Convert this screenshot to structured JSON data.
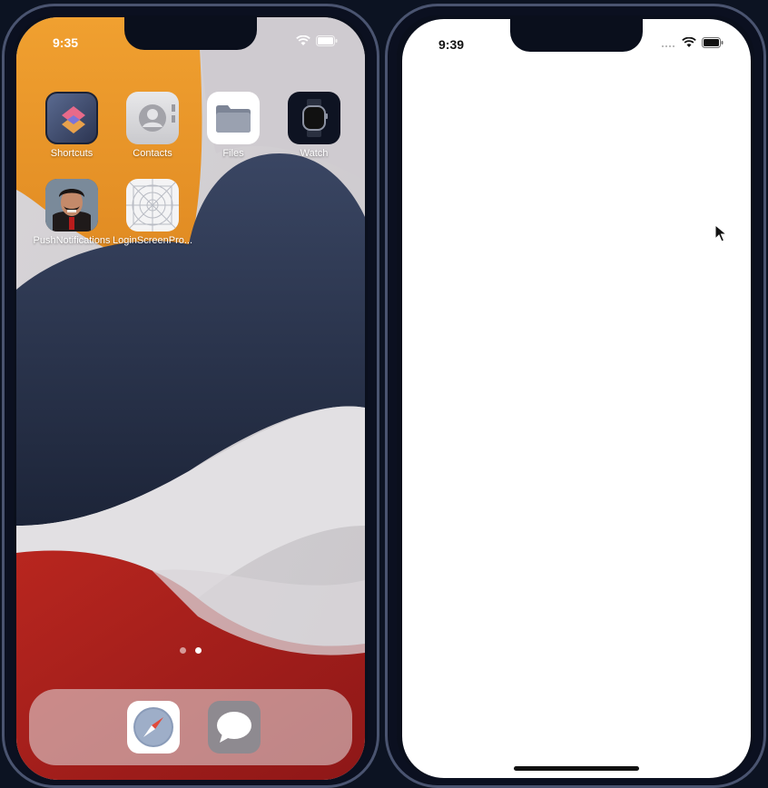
{
  "left_phone": {
    "status": {
      "time": "9:35"
    },
    "apps": [
      {
        "label": "Shortcuts",
        "icon": "shortcuts-icon"
      },
      {
        "label": "Contacts",
        "icon": "contacts-icon"
      },
      {
        "label": "Files",
        "icon": "files-icon"
      },
      {
        "label": "Watch",
        "icon": "watch-icon"
      },
      {
        "label": "PushNotifications",
        "icon": "push-notifications-icon"
      },
      {
        "label": "LoginScreenPro...",
        "icon": "login-screen-icon"
      }
    ],
    "page_dots": {
      "count": 2,
      "active_index": 1
    },
    "dock": [
      {
        "icon": "safari-icon"
      },
      {
        "icon": "messages-icon"
      }
    ]
  },
  "right_phone": {
    "status": {
      "time": "9:39"
    }
  },
  "colors": {
    "frame": "#0c1322",
    "wallpaper_orange": "#e8962a",
    "wallpaper_navy": "#2a3550",
    "wallpaper_red": "#a01c1c",
    "wallpaper_light": "#dcdadd"
  }
}
